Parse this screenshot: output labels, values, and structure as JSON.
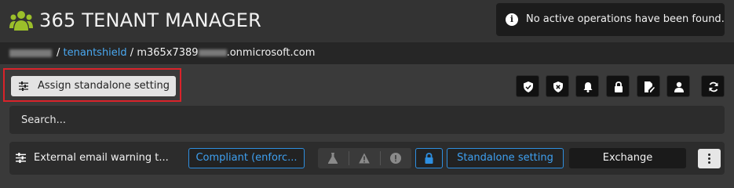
{
  "header": {
    "app_title": "365 TENANT MANAGER",
    "logo_icon": "users-icon",
    "accent_color": "#9bbf2a"
  },
  "toast": {
    "icon": "info-icon",
    "message": "No active operations have been found."
  },
  "breadcrumb": {
    "separator": "/",
    "link": "tenantshield",
    "tenant_prefix": "m365x7389",
    "tenant_suffix": ".onmicrosoft.com"
  },
  "toolbar": {
    "assign_label": "Assign standalone setting",
    "icons": [
      "shield-check-icon",
      "shield-x-icon",
      "bell-icon",
      "lock-icon",
      "edit-document-icon",
      "user-icon",
      "refresh-icon"
    ]
  },
  "search": {
    "placeholder": "Search..."
  },
  "setting_row": {
    "title": "External email warning t...",
    "compliance": "Compliant (enforc...",
    "status_icons": [
      "flask-icon",
      "warning-icon",
      "error-icon"
    ],
    "lock_icon": "lock-icon",
    "type": "Standalone setting",
    "workload": "Exchange",
    "accent_color": "#2e8fe0"
  }
}
